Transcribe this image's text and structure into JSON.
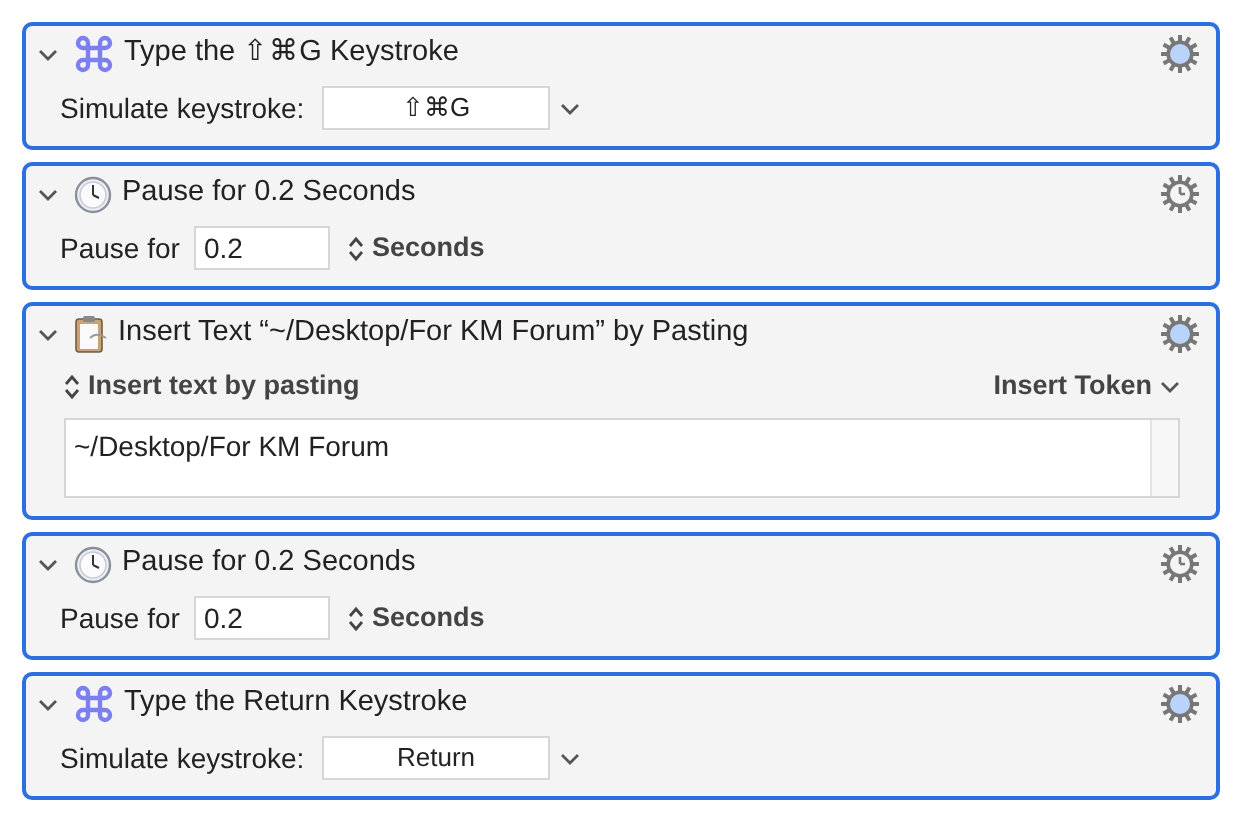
{
  "actions": [
    {
      "kind": "keystroke",
      "title": "Type the ⇧⌘G Keystroke",
      "label": "Simulate keystroke:",
      "value": "⇧⌘G"
    },
    {
      "kind": "pause",
      "title": "Pause for 0.2 Seconds",
      "label": "Pause for",
      "value": "0.2",
      "unit": "Seconds"
    },
    {
      "kind": "insert_text",
      "title": "Insert Text “~/Desktop/For KM Forum” by Pasting",
      "mode": "Insert text by pasting",
      "token_menu": "Insert Token",
      "text": "~/Desktop/For KM Forum"
    },
    {
      "kind": "pause",
      "title": "Pause for 0.2 Seconds",
      "label": "Pause for",
      "value": "0.2",
      "unit": "Seconds"
    },
    {
      "kind": "keystroke",
      "title": "Type the Return Keystroke",
      "label": "Simulate keystroke:",
      "value": "Return"
    }
  ]
}
